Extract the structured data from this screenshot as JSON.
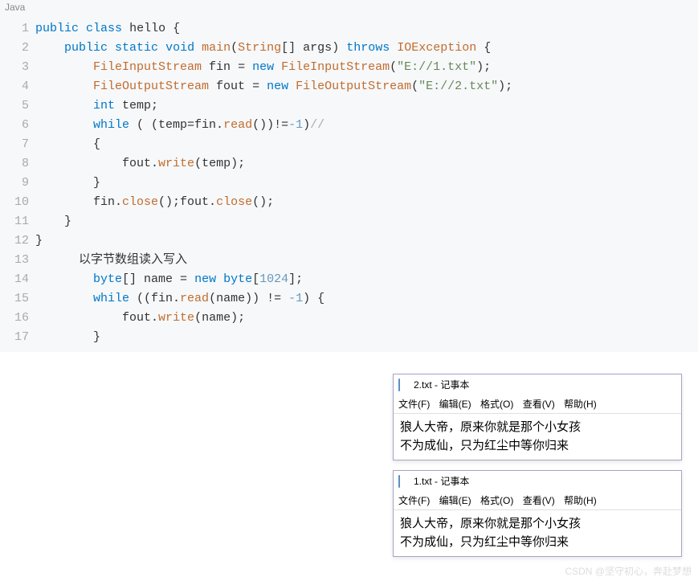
{
  "lang_label": "Java",
  "line_numbers": [
    "1",
    "2",
    "3",
    "4",
    "5",
    "6",
    "7",
    "8",
    "9",
    "10",
    "11",
    "12",
    "13",
    "14",
    "15",
    "16",
    "17"
  ],
  "code": {
    "l1": {
      "kw_public": "public",
      "kw_class": "class",
      "cls": "hello",
      "open": " {"
    },
    "l2": {
      "kw_public": "public",
      "kw_static": "static",
      "kw_void": "void",
      "fn_main": "main",
      "p1": "(",
      "type_str": "String",
      "arr": "[] ",
      "arg": "args",
      "p2": ") ",
      "throws": "throws",
      "exc": "IOException",
      "open": " {"
    },
    "l3": {
      "type": "FileInputStream",
      "var": " fin ",
      "eq": "= ",
      "newkw": "new",
      "ctor": " FileInputStream",
      "p1": "(",
      "str": "\"E://1.txt\"",
      "p2": ");"
    },
    "l4": {
      "type": "FileOutputStream",
      "var": " fout ",
      "eq": "= ",
      "newkw": "new",
      "ctor": " FileOutputStream",
      "p1": "(",
      "str": "\"E://2.txt\"",
      "p2": ");"
    },
    "l5": {
      "type": "int",
      "var": " temp;"
    },
    "l6": {
      "kw": "while",
      "p1": " ( (temp=fin.",
      "fn": "read",
      "p2": "())!=",
      "num": "-1",
      "p3": ")",
      "cm": "//"
    },
    "l7": {
      "open": "{"
    },
    "l8": {
      "pre": "fout.",
      "fn": "write",
      "p": "(temp);"
    },
    "l9": {
      "close": "}"
    },
    "l10": {
      "p1": "fin.",
      "fn1": "close",
      "p2": "();fout.",
      "fn2": "close",
      "p3": "();"
    },
    "l11": {
      "close": "}"
    },
    "l12": {
      "close": "}"
    },
    "l13": {
      "comment": "以字节数组读入写入"
    },
    "l14": {
      "type": "byte",
      "arr": "[] name ",
      "eq": "= ",
      "newkw": "new",
      "type2": " byte",
      "br1": "[",
      "num": "1024",
      "br2": "];"
    },
    "l15": {
      "kw": "while",
      "p1": " ((fin.",
      "fn": "read",
      "p2": "(name)) != ",
      "num": "-1",
      "p3": ") {"
    },
    "l16": {
      "pre": "fout.",
      "fn": "write",
      "p": "(name);"
    },
    "l17": {
      "close": "}"
    }
  },
  "notepad": {
    "menu": {
      "file": "文件(F)",
      "edit": "编辑(E)",
      "format": "格式(O)",
      "view": "查看(V)",
      "help": "帮助(H)"
    },
    "w1": {
      "title": "2.txt - 记事本",
      "line1": "狼人大帝，原来你就是那个小女孩",
      "line2": "不为成仙，只为红尘中等你归来"
    },
    "w2": {
      "title": "1.txt - 记事本",
      "line1": "狼人大帝，原来你就是那个小女孩",
      "line2": "不为成仙，只为红尘中等你归来"
    }
  },
  "watermark": "CSDN @坚守初心，奔赴梦想"
}
